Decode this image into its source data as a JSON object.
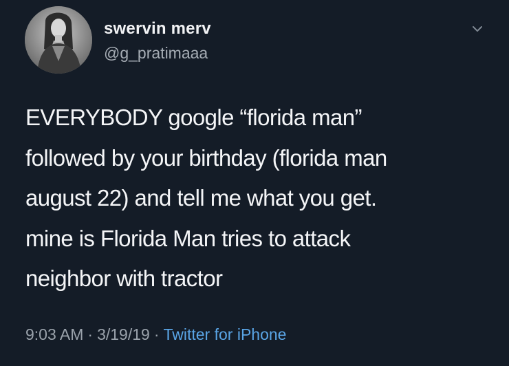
{
  "user": {
    "display_name": "swervin merv",
    "handle": "@g_pratimaaa"
  },
  "tweet": {
    "lines": [
      "EVERYBODY google “florida man”",
      "followed by your birthday (florida man",
      "august 22) and tell me what you get.",
      "mine is Florida Man tries to attack",
      "neighbor with tractor"
    ],
    "time": "9:03 AM",
    "separator": "·",
    "date": "3/19/19",
    "source": "Twitter for iPhone"
  },
  "icons": {
    "menu": "chevron-down-icon",
    "avatar": "profile-photo"
  },
  "colors": {
    "background": "#141c27",
    "link": "#5aa5e6",
    "text": "#f4f5f7",
    "muted": "#9aa2ab"
  }
}
